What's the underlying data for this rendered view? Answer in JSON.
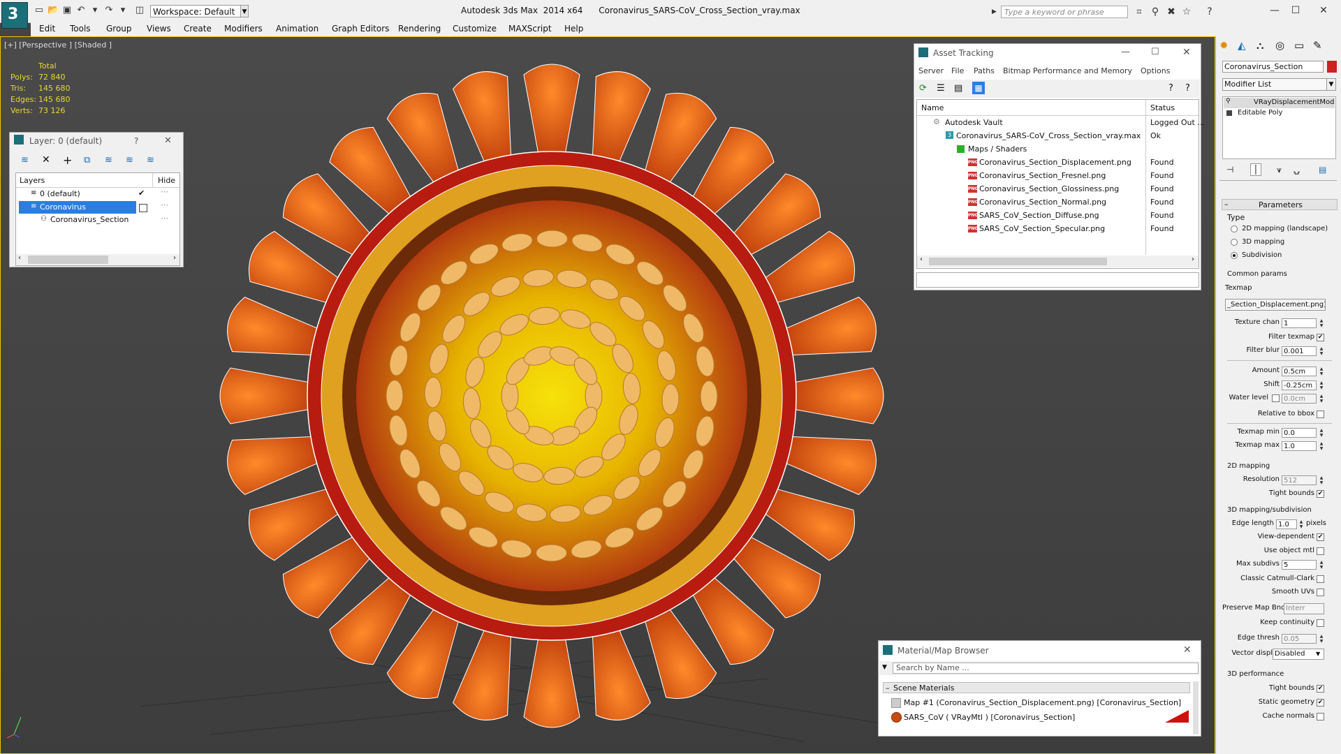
{
  "titlebar": {
    "workspace_value": "Workspace: Default",
    "app_name": "Autodesk 3ds Max  2014 x64",
    "file_name": "Coronavirus_SARS-CoV_Cross_Section_vray.max",
    "search_placeholder": "Type a keyword or phrase"
  },
  "menu": [
    "Edit",
    "Tools",
    "Group",
    "Views",
    "Create",
    "Modifiers",
    "Animation",
    "Graph Editors",
    "Rendering",
    "Customize",
    "MAXScript",
    "Help"
  ],
  "viewport": {
    "label": "[+] [Perspective ] [Shaded ]",
    "stats_header": "Total",
    "stats": [
      {
        "label": "Polys:",
        "value": "72 840"
      },
      {
        "label": "Tris:",
        "value": "145 680"
      },
      {
        "label": "Edges:",
        "value": "145 680"
      },
      {
        "label": "Verts:",
        "value": "73 126"
      }
    ]
  },
  "layer_panel": {
    "title": "Layer: 0 (default)",
    "help": "?",
    "col_layers": "Layers",
    "col_hide": "Hide",
    "rows": [
      "0 (default)",
      "Coronavirus",
      "Coronavirus_Section"
    ]
  },
  "asset_tracking": {
    "title": "Asset Tracking",
    "menu": [
      "Server",
      "File",
      "Paths",
      "Bitmap Performance and Memory",
      "Options"
    ],
    "col_name": "Name",
    "col_status": "Status",
    "rows": [
      {
        "name": "Autodesk Vault",
        "status": "Logged Out ..."
      },
      {
        "name": "Coronavirus_SARS-CoV_Cross_Section_vray.max",
        "status": "Ok"
      },
      {
        "name": "Maps / Shaders",
        "status": ""
      },
      {
        "name": "Coronavirus_Section_Displacement.png",
        "status": "Found"
      },
      {
        "name": "Coronavirus_Section_Fresnel.png",
        "status": "Found"
      },
      {
        "name": "Coronavirus_Section_Glossiness.png",
        "status": "Found"
      },
      {
        "name": "Coronavirus_Section_Normal.png",
        "status": "Found"
      },
      {
        "name": "SARS_CoV_Section_Diffuse.png",
        "status": "Found"
      },
      {
        "name": "SARS_CoV_Section_Specular.png",
        "status": "Found"
      }
    ]
  },
  "material_browser": {
    "title": "Material/Map Browser",
    "search_placeholder": "Search by Name ...",
    "group": "Scene Materials",
    "items": [
      "Map #1 (Coronavirus_Section_Displacement.png) [Coronavirus_Section]",
      "SARS_CoV  ( VRayMtl ) [Coronavirus_Section]"
    ]
  },
  "command_panel": {
    "object_name": "Coronavirus_Section",
    "object_color": "#cc2222",
    "modifier_list": "Modifier List",
    "stack": [
      "VRayDisplacementMod",
      "Editable Poly"
    ],
    "rollout": "Parameters",
    "type_label": "Type",
    "type_options": [
      "2D mapping (landscape)",
      "3D mapping",
      "Subdivision"
    ],
    "common_params": "Common params",
    "texmap_label": "Texmap",
    "texmap_value": "_Section_Displacement.png)",
    "fields1": [
      {
        "label": "Texture chan",
        "value": "1"
      }
    ],
    "filter_texmap": "Filter texmap",
    "filter_blur": {
      "label": "Filter blur",
      "value": "0.001"
    },
    "amount": {
      "label": "Amount",
      "value": "0.5cm"
    },
    "shift": {
      "label": "Shift",
      "value": "-0.25cm"
    },
    "water_level": {
      "label": "Water level",
      "value": "0.0cm"
    },
    "relative_bbox": "Relative to bbox",
    "texmap_min": {
      "label": "Texmap min",
      "value": "0.0"
    },
    "texmap_max": {
      "label": "Texmap max",
      "value": "1.0"
    },
    "mapping2d": "2D mapping",
    "resolution": {
      "label": "Resolution",
      "value": "512"
    },
    "tight_bounds": "Tight bounds",
    "mapping3d": "3D mapping/subdivision",
    "edge_length": {
      "label": "Edge length",
      "value": "1.0",
      "unit": "pixels"
    },
    "view_dependent": "View-dependent",
    "use_object_mtl": "Use object mtl",
    "max_subdivs": {
      "label": "Max subdivs",
      "value": "5"
    },
    "classic_catmull": "Classic Catmull-Clark",
    "smooth_uvs": "Smooth UVs",
    "preserve_map": {
      "label": "Preserve Map Bnd",
      "value": "Interr"
    },
    "keep_continuity": "Keep continuity",
    "edge_thresh": {
      "label": "Edge thresh",
      "value": "0.05"
    },
    "vector_displ": {
      "label": "Vector displ",
      "value": "Disabled"
    },
    "perf": "3D performance",
    "perf_tight": "Tight bounds",
    "static_geom": "Static geometry",
    "cache_normals": "Cache normals"
  }
}
